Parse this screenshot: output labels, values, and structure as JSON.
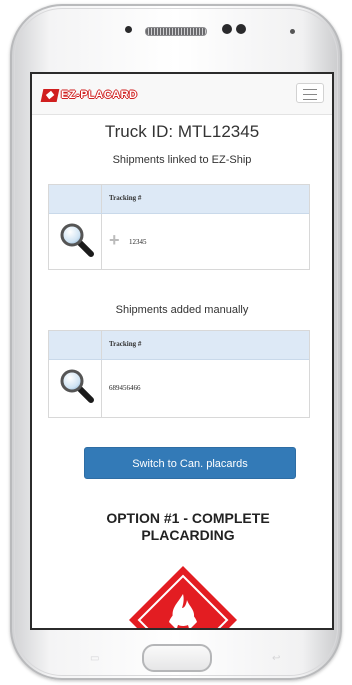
{
  "app": {
    "logo_text": "EZ-PLACARD",
    "menu_icon": "hamburger-icon"
  },
  "truck": {
    "title": "Truck ID: MTL12345"
  },
  "linked": {
    "label": "Shipments linked to EZ-Ship",
    "column_header": "Tracking #",
    "rows": [
      {
        "tracking": "12345",
        "icon": "magnifier-icon",
        "expand_icon": "plus-icon"
      }
    ]
  },
  "manual": {
    "label": "Shipments added manually",
    "column_header": "Tracking #",
    "rows": [
      {
        "tracking": "689456466",
        "icon": "magnifier-icon"
      }
    ]
  },
  "switch_button": {
    "label": "Switch to Can. placards"
  },
  "option": {
    "title": "OPTION #1 - COMPLETE PLACARDING"
  },
  "placard": {
    "icon": "flammable-placard-icon",
    "color": "#e31d22"
  },
  "colors": {
    "primary_button": "#337ab7",
    "table_header": "#dde9f6",
    "logo_red": "#d01f1f"
  }
}
